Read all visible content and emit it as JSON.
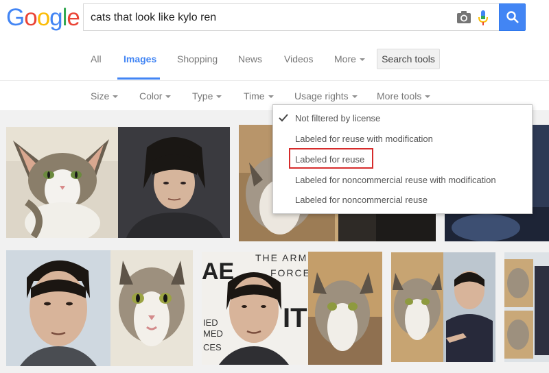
{
  "header": {
    "logo_letters": [
      "G",
      "o",
      "o",
      "g",
      "l",
      "e"
    ],
    "logo_colors": [
      "#4285f4",
      "#ea4335",
      "#fbbc05",
      "#4285f4",
      "#34a853",
      "#ea4335"
    ],
    "search_value": "cats that look like kylo ren",
    "icons": [
      "camera-icon",
      "microphone-icon",
      "search-icon"
    ],
    "accent": "#4285f4"
  },
  "tabs": {
    "items": [
      "All",
      "Images",
      "Shopping",
      "News",
      "Videos",
      "More"
    ],
    "active": "Images",
    "search_tools": "Search tools"
  },
  "tools": {
    "items": [
      "Size",
      "Color",
      "Type",
      "Time",
      "Usage rights",
      "More tools"
    ]
  },
  "usage_rights_menu": {
    "items": [
      "Not filtered by license",
      "Labeled for reuse with modification",
      "Labeled for reuse",
      "Labeled for noncommercial reuse with modification",
      "Labeled for noncommercial reuse"
    ],
    "checked": "Not filtered by license",
    "highlighted": "Labeled for reuse",
    "highlight_color": "#d62b2b"
  },
  "images": {
    "poster_text": [
      "THE ARM",
      "FORCE",
      "AE",
      "IT",
      "IED",
      "MED",
      "CES"
    ]
  }
}
